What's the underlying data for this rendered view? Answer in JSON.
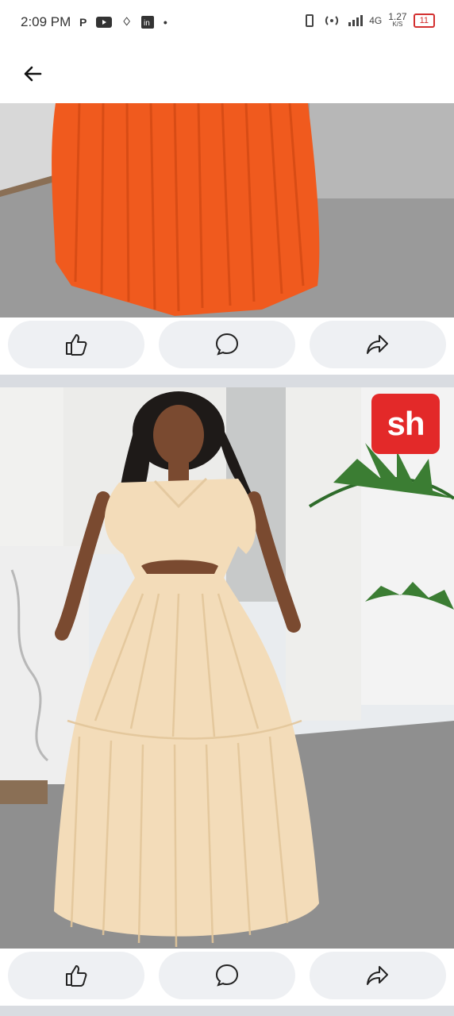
{
  "status_bar": {
    "time": "2:09 PM",
    "network": "4G",
    "speed_value": "1.27",
    "speed_unit": "K/S",
    "battery": "11"
  },
  "header": {
    "back_icon": "arrow-left-icon"
  },
  "posts": [
    {
      "image_description_hidden": "",
      "actions": [
        "like-icon",
        "comment-icon",
        "share-icon"
      ]
    },
    {
      "badge": "sh",
      "actions": [
        "like-icon",
        "comment-icon",
        "share-icon"
      ]
    }
  ],
  "colors": {
    "orange_dress": "#f05a1e",
    "beige_dress": "#f3dcb9",
    "floor": "#8f8f8f",
    "badge_red": "#e32929"
  }
}
